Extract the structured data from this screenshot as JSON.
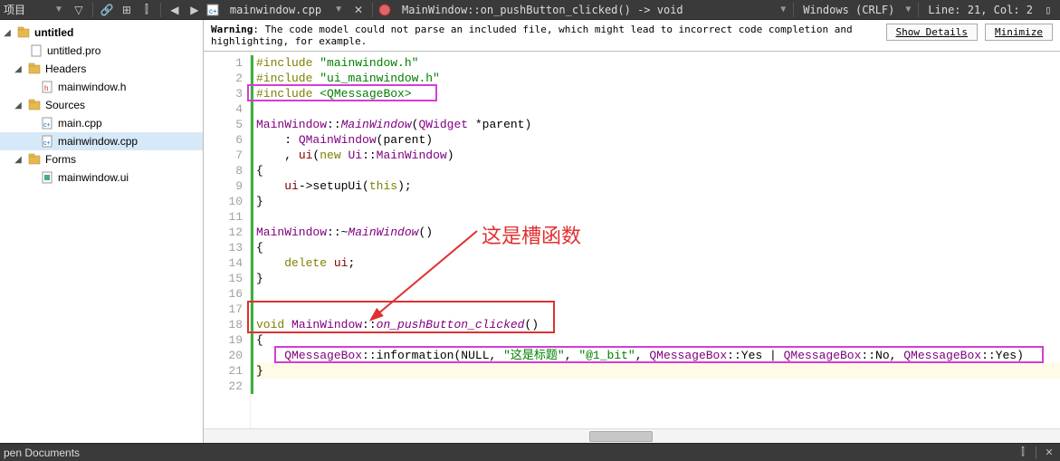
{
  "toolbar": {
    "label_projects": "项目",
    "breadcrumb_file": "mainwindow.cpp",
    "breadcrumb_func": "MainWindow::on_pushButton_clicked() -> void",
    "encoding": "Windows (CRLF)",
    "line_col": "Line: 21, Col: 2"
  },
  "warning": {
    "prefix": "Warning",
    "text": ": The code model could not parse an included file, which might lead to incorrect code completion and highlighting, for example.",
    "btn_details": "Show Details",
    "btn_minimize": "Minimize"
  },
  "tree": {
    "root": "untitled",
    "pro": "untitled.pro",
    "headers": "Headers",
    "h1": "mainwindow.h",
    "sources": "Sources",
    "s1": "main.cpp",
    "s2": "mainwindow.cpp",
    "forms": "Forms",
    "f1": "mainwindow.ui"
  },
  "code": {
    "l1": "#include \"mainwindow.h\"",
    "l2": "#include \"ui_mainwindow.h\"",
    "l3": "#include <QMessageBox>",
    "l5a": "MainWindow::",
    "l5b": "MainWindow",
    "l5c": "(QWidget *parent)",
    "l6": "    : QMainWindow(parent)",
    "l7a": "    , ui(",
    "l7b": "new",
    "l7c": " Ui::MainWindow)",
    "l8": "{",
    "l9a": "    ui->setupUi(",
    "l9b": "this",
    "l9c": ");",
    "l10": "}",
    "l12a": "MainWindow::~",
    "l12b": "MainWindow",
    "l12c": "()",
    "l13": "{",
    "l14a": "    ",
    "l14b": "delete",
    "l14c": " ui;",
    "l15": "}",
    "l17": "",
    "l18a": "void",
    "l18b": " MainWindow::",
    "l18c": "on_pushButton_clicked",
    "l18d": "()",
    "l19": "{",
    "l20a": "    QMessageBox::",
    "l20b": "information",
    "l20c": "(NULL, ",
    "l20d": "\"这是标题\"",
    "l20e": ", ",
    "l20f": "\"@1_bit\"",
    "l20g": ", QMessageBox::Yes | QMessageBox::No, QMessageBox::Yes)",
    "l21": "}"
  },
  "annotation_text": "这是槽函数",
  "bottom": {
    "label": "pen Documents"
  },
  "line_numbers": [
    "1",
    "2",
    "3",
    "4",
    "5",
    "6",
    "7",
    "8",
    "9",
    "10",
    "11",
    "12",
    "13",
    "14",
    "15",
    "16",
    "17",
    "18",
    "19",
    "20",
    "21",
    "22"
  ]
}
